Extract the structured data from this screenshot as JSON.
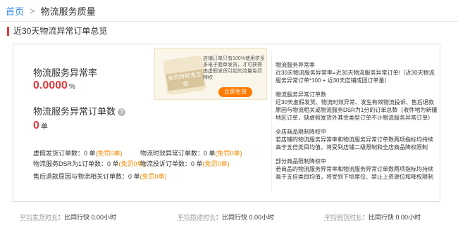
{
  "breadcrumb": {
    "home": "首页",
    "separator": ">",
    "current": "物流服务质量"
  },
  "section_title": "近30天物流异常订单总览",
  "metrics": {
    "rate_label": "物流服务异常率",
    "rate_value": "0.0000",
    "rate_unit": "%",
    "count_label": "物流服务异常订单数",
    "count_value": "0",
    "count_unit": "单",
    "help_icon": "?"
  },
  "rows": [
    {
      "label": "虚假发货订单数：",
      "value": "0 单",
      "link": "(免罚0单)"
    },
    {
      "label": "物流时效异常订单数：",
      "value": "0 单",
      "link": "(免罚0单)"
    },
    {
      "label": "物流服务DSR为1订单数：",
      "value": "0 单",
      "link": "(免罚0单)"
    },
    {
      "label": "物流投诉订单数：",
      "value": "0 单",
      "link": "(免罚0单)"
    },
    {
      "label": "售后退款原因与物流相关订单数：",
      "value": "0 单",
      "link": "(免罚0单)"
    }
  ],
  "promo": {
    "badge_text": "免罚特权未生效",
    "text": "店铺订单只有100%使用拼多多电子面单发货，才可获得由虚假发货引起的流量免罚特权",
    "button": "立即生效"
  },
  "notes": [
    {
      "title": "物流服务异常率",
      "body": "近30天物流服务异常率=近30天物流服务异常订单/（近30天物流服务异常订单*100 + 近30天店铺成团订单量）"
    },
    {
      "title": "物流服务异常订单数",
      "body": "近30天虚假发货、物流时效异常、发生有效物流投诉、售后退款原因与物流相关或物流服务DSR为1分的订单总数（收件地为新疆地区订单，缺虚假发货外其余类型订单不计物流服务异常订单）"
    },
    {
      "title": "全店商品限制降权中",
      "body": "若店铺的物流服务异常率和物流服务异常订单数两项指标均持续高于五倍类目均值，将受到店铺二级限制和全店商品降权限制"
    },
    {
      "title": "部分商品限制降权中",
      "body": "若商品的物流服务异常率和物流服务异常订单数两项指标均持续高于五倍类目均值，将受到下坝席位、禁止上资源位和降权限制"
    }
  ],
  "bottom_stats": [
    {
      "label": "平均发货时长",
      "sep": "：",
      "value": "比同行快 0.00小时"
    },
    {
      "label": "平均揽收时长",
      "sep": "：",
      "value": "比同行快 0.00小时"
    },
    {
      "label": "平均到货时长",
      "sep": "：",
      "value": "比同行快 0.00小时"
    }
  ]
}
